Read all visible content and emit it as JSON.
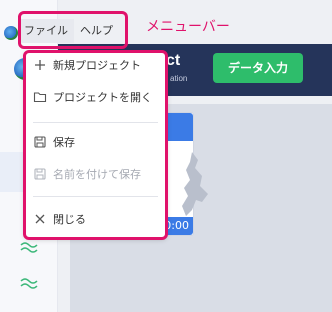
{
  "menubar": {
    "items": [
      {
        "label": "ファイル"
      },
      {
        "label": "ヘルプ"
      }
    ],
    "callout_label": "メニューバー"
  },
  "file_menu": {
    "items": [
      {
        "label": "新規プロジェクト",
        "icon": "plus-icon",
        "enabled": true
      },
      {
        "label": "プロジェクトを開く",
        "icon": "folder-icon",
        "enabled": true
      },
      {
        "label": "保存",
        "icon": "save-icon",
        "enabled": true
      },
      {
        "label": "名前を付けて保存",
        "icon": "save-as-icon",
        "enabled": false
      },
      {
        "label": "閉じる",
        "icon": "close-icon",
        "enabled": true
      }
    ]
  },
  "background_app": {
    "title_fragment": "ct",
    "subtitle_fragment": "ation",
    "data_input_button": "データ入力",
    "card_time": "0:00"
  },
  "colors": {
    "highlight": "#e0126b",
    "header": "#25345a",
    "accent_green": "#2ebd6b",
    "accent_blue": "#3b7be6"
  }
}
